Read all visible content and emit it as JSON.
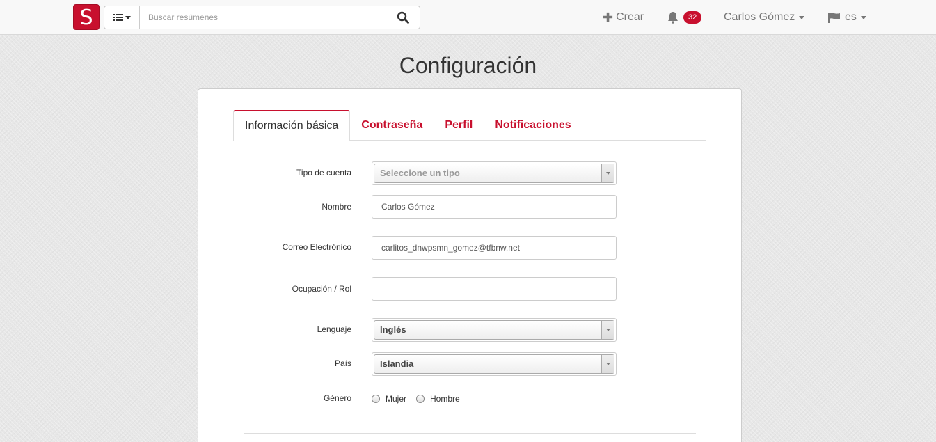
{
  "navbar": {
    "logo_letter": "S",
    "search_placeholder": "Buscar resúmenes",
    "create_label": "Crear",
    "notifications_count": "32",
    "user_name": "Carlos Gómez",
    "language": "es"
  },
  "page": {
    "title": "Configuración"
  },
  "tabs": [
    {
      "label": "Información básica",
      "active": true
    },
    {
      "label": "Contraseña",
      "active": false
    },
    {
      "label": "Perfil",
      "active": false
    },
    {
      "label": "Notificaciones",
      "active": false
    }
  ],
  "form": {
    "account_type": {
      "label": "Tipo de cuenta",
      "placeholder": "Seleccione un tipo"
    },
    "name": {
      "label": "Nombre",
      "value": "Carlos Gómez"
    },
    "email": {
      "label": "Correo Electrónico",
      "value": "carlitos_dnwpsmn_gomez@tfbnw.net"
    },
    "occupation": {
      "label": "Ocupación / Rol",
      "value": ""
    },
    "language": {
      "label": "Lenguaje",
      "value": "Inglés"
    },
    "country": {
      "label": "País",
      "value": "Islandia"
    },
    "gender": {
      "label": "Género",
      "options": [
        "Mujer",
        "Hombre"
      ]
    }
  },
  "colors": {
    "accent": "#c8102e"
  }
}
